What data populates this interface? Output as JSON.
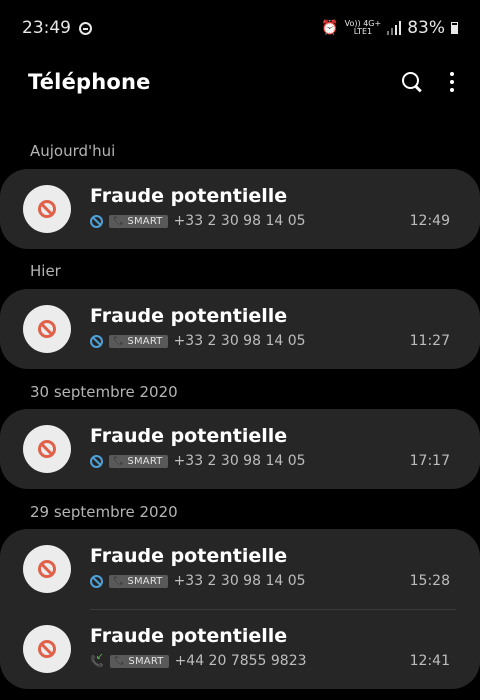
{
  "status": {
    "time": "23:49",
    "net_top": "Vo)) 4G+",
    "net_bottom": "LTE1",
    "battery": "83%"
  },
  "app": {
    "title": "Téléphone"
  },
  "groups": [
    {
      "date": "Aujourd'hui",
      "calls": [
        {
          "name": "Fraude potentielle",
          "badge": "SMART",
          "number": "+33 2 30 98 14 05",
          "time": "12:49",
          "type": "blocked"
        }
      ]
    },
    {
      "date": "Hier",
      "calls": [
        {
          "name": "Fraude potentielle",
          "badge": "SMART",
          "number": "+33 2 30 98 14 05",
          "time": "11:27",
          "type": "blocked"
        }
      ]
    },
    {
      "date": "30 septembre 2020",
      "calls": [
        {
          "name": "Fraude potentielle",
          "badge": "SMART",
          "number": "+33 2 30 98 14 05",
          "time": "17:17",
          "type": "blocked"
        }
      ]
    },
    {
      "date": "29 septembre 2020",
      "calls": [
        {
          "name": "Fraude potentielle",
          "badge": "SMART",
          "number": "+33 2 30 98 14 05",
          "time": "15:28",
          "type": "blocked"
        },
        {
          "name": "Fraude potentielle",
          "badge": "SMART",
          "number": "+44 20 7855 9823",
          "time": "12:41",
          "type": "incoming"
        }
      ]
    }
  ],
  "colors": {
    "block_red": "#e0604a",
    "blocked_blue": "#4ea0d8",
    "incoming_green": "#63c35a",
    "card_bg": "#262626"
  }
}
